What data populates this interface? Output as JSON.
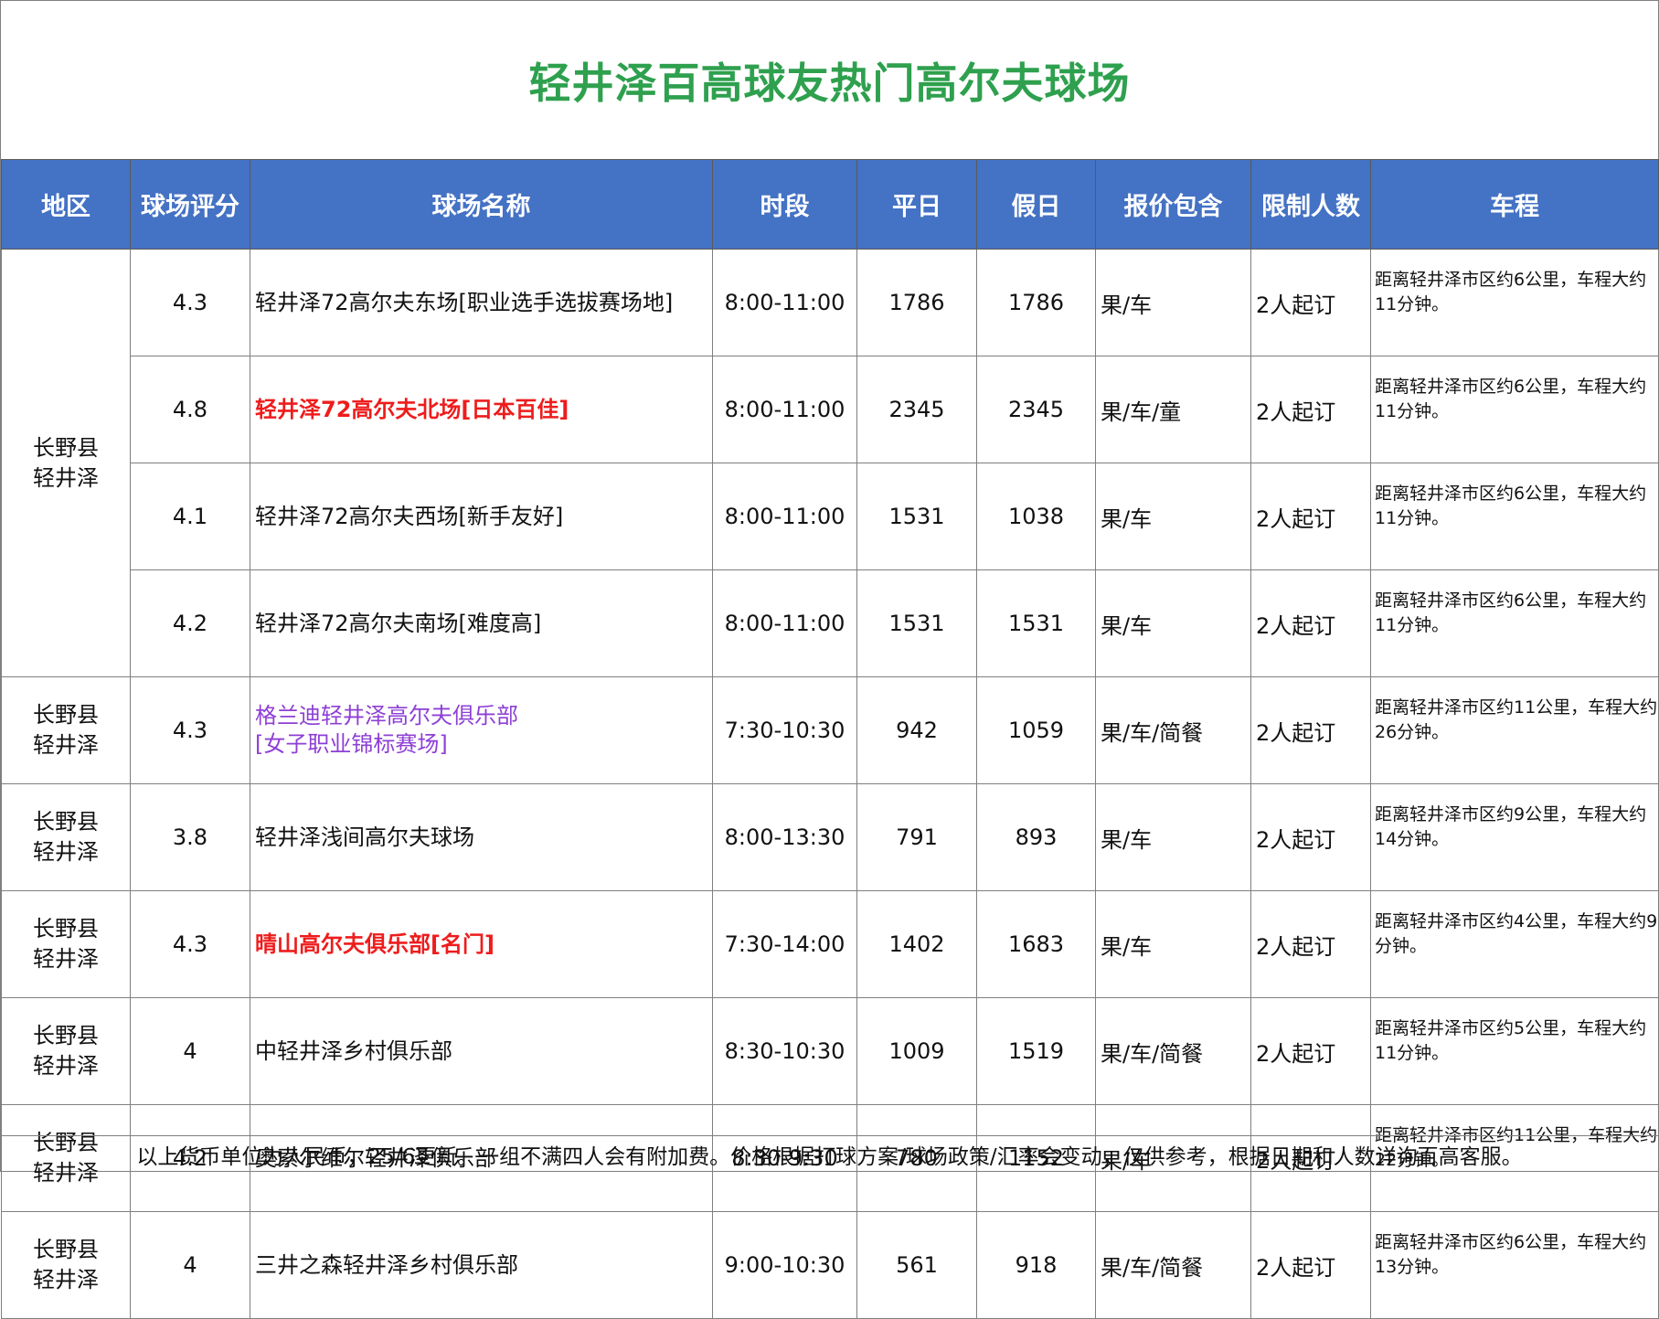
{
  "title": "轻井泽百高球友热门高尔夫球场",
  "headers": [
    "地区",
    "球场评分",
    "球场名称",
    "时段",
    "平日",
    "假日",
    "报价包含",
    "限制人数",
    "车程"
  ],
  "group_region": [
    "长野县",
    "轻井泽"
  ],
  "rows": [
    {
      "rating": "4.3",
      "name": "轻井泽72高尔夫东场[职业选手选拔赛场地]",
      "name_lines": [
        "轻井泽72高尔夫东场[职业选手选拔赛场地]"
      ],
      "style": "normal",
      "time": "8:00-11:00",
      "weekday": "1786",
      "holiday": "1786",
      "includes": "果/车",
      "limit": "2人起订",
      "distance": [
        "距离轻井泽市区约6公里，车程大约",
        "11分钟。"
      ]
    },
    {
      "rating": "4.8",
      "name": "轻井泽72高尔夫北场[日本百佳]",
      "name_lines": [
        "轻井泽72高尔夫北场[日本百佳]"
      ],
      "style": "red",
      "time": "8:00-11:00",
      "weekday": "2345",
      "holiday": "2345",
      "includes": "果/车/童",
      "limit": "2人起订",
      "distance": [
        "距离轻井泽市区约6公里，车程大约",
        "11分钟。"
      ]
    },
    {
      "rating": "4.1",
      "name": "轻井泽72高尔夫西场[新手友好]",
      "name_lines": [
        "轻井泽72高尔夫西场[新手友好]"
      ],
      "style": "normal",
      "time": "8:00-11:00",
      "weekday": "1531",
      "holiday": "1038",
      "includes": "果/车",
      "limit": "2人起订",
      "distance": [
        "距离轻井泽市区约6公里，车程大约",
        "11分钟。"
      ]
    },
    {
      "rating": "4.2",
      "name": "轻井泽72高尔夫南场[难度高]",
      "name_lines": [
        "轻井泽72高尔夫南场[难度高]"
      ],
      "style": "normal",
      "time": "8:00-11:00",
      "weekday": "1531",
      "holiday": "1531",
      "includes": "果/车",
      "limit": "2人起订",
      "distance": [
        "距离轻井泽市区约6公里，车程大约",
        "11分钟。"
      ]
    },
    {
      "region": [
        "长野县",
        "轻井泽"
      ],
      "rating": "4.3",
      "name_lines": [
        "格兰迪轻井泽高尔夫俱乐部",
        "[女子职业锦标赛场]"
      ],
      "style": "purple",
      "time": "7:30-10:30",
      "weekday": "942",
      "holiday": "1059",
      "includes": "果/车/简餐",
      "limit": "2人起订",
      "distance": [
        "距离轻井泽市区约11公里，车程大约",
        "26分钟。"
      ]
    },
    {
      "region": [
        "长野县",
        "轻井泽"
      ],
      "rating": "3.8",
      "name_lines": [
        "轻井泽浅间高尔夫球场"
      ],
      "style": "normal",
      "time": "8:00-13:30",
      "weekday": "791",
      "holiday": "893",
      "includes": "果/车",
      "limit": "2人起订",
      "distance": [
        "距离轻井泽市区约9公里，车程大约",
        "14分钟。"
      ]
    },
    {
      "region": [
        "长野县",
        "轻井泽"
      ],
      "rating": "4.3",
      "name_lines": [
        "晴山高尔夫俱乐部[名门]"
      ],
      "style": "red",
      "time": "7:30-14:00",
      "weekday": "1402",
      "holiday": "1683",
      "includes": "果/车",
      "limit": "2人起订",
      "distance": [
        "距离轻井泽市区约4公里，车程大约9",
        "分钟。"
      ]
    },
    {
      "region": [
        "长野县",
        "轻井泽"
      ],
      "rating": "4",
      "name_lines": [
        "中轻井泽乡村俱乐部"
      ],
      "style": "normal",
      "time": "8:30-10:30",
      "weekday": "1009",
      "holiday": "1519",
      "includes": "果/车/简餐",
      "limit": "2人起订",
      "distance": [
        "距离轻井泽市区约5公里，车程大约",
        "11分钟。"
      ]
    },
    {
      "region": [
        "长野县",
        "轻井泽"
      ],
      "rating": "4.2",
      "name_lines": [
        "奥索尔维尔轻井泽俱乐部"
      ],
      "style": "normal",
      "time": "8:30-9:30",
      "weekday": "780",
      "holiday": "1152",
      "includes": "果/车",
      "limit": "2人起订",
      "distance": [
        "距离轻井泽市区约11公里，车程大约",
        "22分钟。"
      ]
    },
    {
      "region": [
        "长野县",
        "轻井泽"
      ],
      "rating": "4",
      "name_lines": [
        "三井之森轻井泽乡村俱乐部"
      ],
      "style": "normal",
      "time": "9:00-10:30",
      "weekday": "561",
      "holiday": "918",
      "includes": "果/车/简餐",
      "limit": "2人起订",
      "distance": [
        "距离轻井泽市区约6公里，车程大约",
        "13分钟。"
      ]
    }
  ],
  "footer": "以上货币单位为人民币，25/6更新。一组不满四人会有附加费。价格根据打球方案/球场政策/汇率会变动，仅供参考，根据日期和人数详询百高客服。"
}
